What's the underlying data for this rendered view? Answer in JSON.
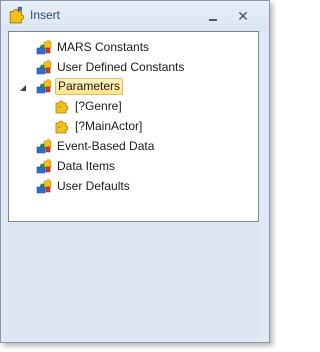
{
  "window": {
    "title": "Insert",
    "minimize_symbol": "",
    "close_symbol": "✕"
  },
  "tree": {
    "items": [
      {
        "label": "MARS Constants",
        "icon": "puzzle-pieces-icon"
      },
      {
        "label": "User Defined Constants",
        "icon": "puzzle-pieces-icon"
      },
      {
        "label": "Parameters",
        "icon": "puzzle-pieces-icon",
        "expanded": true,
        "selected": true
      },
      {
        "label": "[?Genre]",
        "icon": "yellow-puzzle-icon"
      },
      {
        "label": "[?MainActor]",
        "icon": "yellow-puzzle-icon"
      },
      {
        "label": "Event-Based Data",
        "icon": "puzzle-pieces-icon"
      },
      {
        "label": "Data Items",
        "icon": "puzzle-pieces-icon"
      },
      {
        "label": "User Defaults",
        "icon": "puzzle-pieces-icon"
      }
    ]
  },
  "colors": {
    "title_text": "#2d4a75",
    "selection_fill": "#ffe38d",
    "selection_border": "#e6be5a",
    "puzzle_blue": "#2f6fd1",
    "puzzle_green": "#3c9a2a",
    "puzzle_yellow": "#f2c21a"
  }
}
